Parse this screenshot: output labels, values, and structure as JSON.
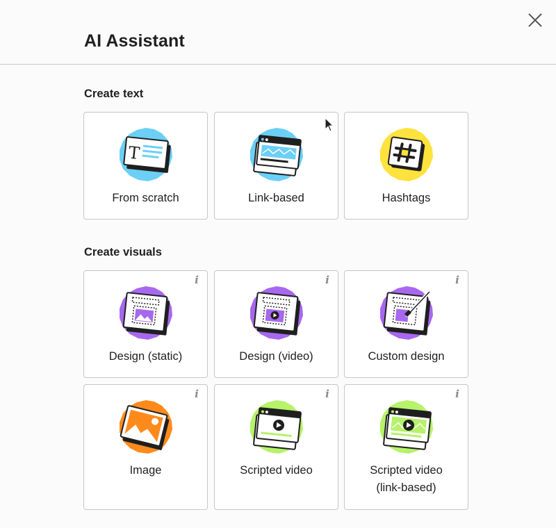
{
  "header": {
    "title": "AI Assistant"
  },
  "sections": {
    "text": {
      "title": "Create text",
      "cards": [
        {
          "label": "From scratch",
          "icon": "text-document-icon"
        },
        {
          "label": "Link-based",
          "icon": "browser-link-icon"
        },
        {
          "label": "Hashtags",
          "icon": "hashtag-icon"
        }
      ]
    },
    "visuals": {
      "title": "Create visuals",
      "cards": [
        {
          "label": "Design (static)",
          "icon": "design-static-icon",
          "info": "i"
        },
        {
          "label": "Design (video)",
          "icon": "design-video-icon",
          "info": "i"
        },
        {
          "label": "Custom design",
          "icon": "custom-design-icon",
          "info": "i"
        },
        {
          "label": "Image",
          "icon": "image-icon",
          "info": "i"
        },
        {
          "label": "Scripted video",
          "icon": "scripted-video-icon",
          "info": "i"
        },
        {
          "label": "Scripted video\n(link-based)",
          "icon": "scripted-video-link-icon",
          "info": "i"
        }
      ]
    }
  },
  "colors": {
    "blue": "#6ccff6",
    "yellow": "#ffe23d",
    "purple": "#a768ef",
    "orange": "#ff8a1c",
    "green": "#b6f26a"
  }
}
